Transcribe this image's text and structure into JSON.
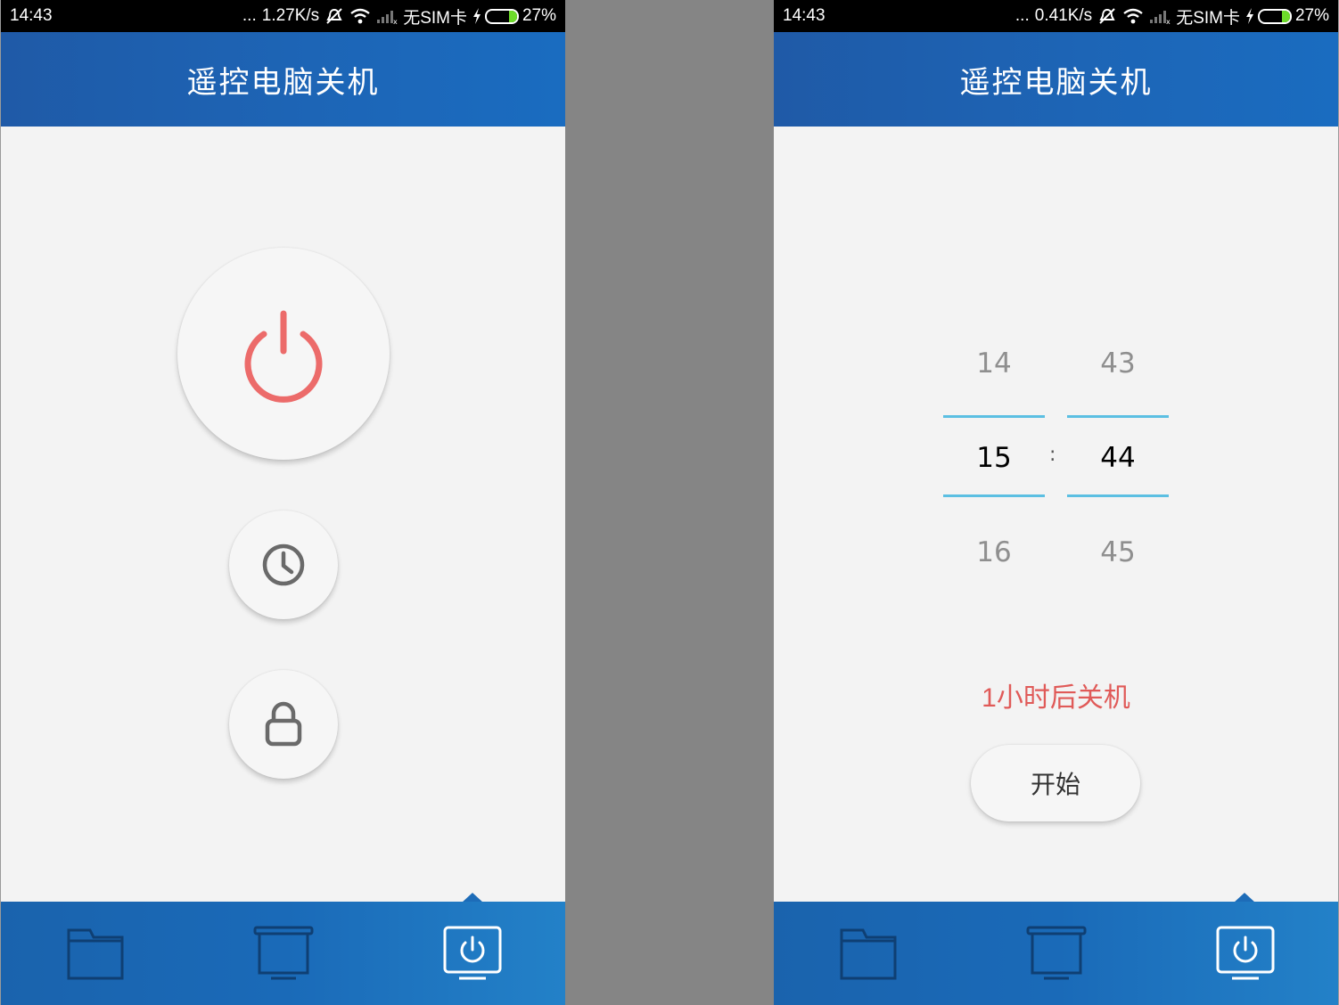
{
  "screens": [
    {
      "status": {
        "time": "14:43",
        "dots": "...",
        "speed": "1.27K/s",
        "carrier": "无SIM卡",
        "battery_text": "27%",
        "battery_level": 0.27
      },
      "header": {
        "title": "遥控电脑关机"
      },
      "actions": {
        "power_icon": "power-icon",
        "timer_icon": "clock-icon",
        "lock_icon": "lock-icon"
      },
      "nav": {
        "items": [
          "folder-icon",
          "screen-icon",
          "power-monitor-icon"
        ],
        "active": 2
      }
    },
    {
      "status": {
        "time": "14:43",
        "dots": "...",
        "speed": "0.41K/s",
        "carrier": "无SIM卡",
        "battery_text": "27%",
        "battery_level": 0.27
      },
      "header": {
        "title": "遥控电脑关机"
      },
      "picker": {
        "hours": {
          "prev": "14",
          "current": "15",
          "next": "16"
        },
        "separator": ":",
        "minutes": {
          "prev": "43",
          "current": "44",
          "next": "45"
        }
      },
      "countdown": "1小时后关机",
      "start_label": "开始",
      "nav": {
        "items": [
          "folder-icon",
          "screen-icon",
          "power-monitor-icon"
        ],
        "active": 2
      }
    }
  ],
  "colors": {
    "header": "#1d62b2",
    "accent_red": "#ec6b6a",
    "picker_line": "#5bbfe2",
    "nav": "#1a6ab8"
  }
}
